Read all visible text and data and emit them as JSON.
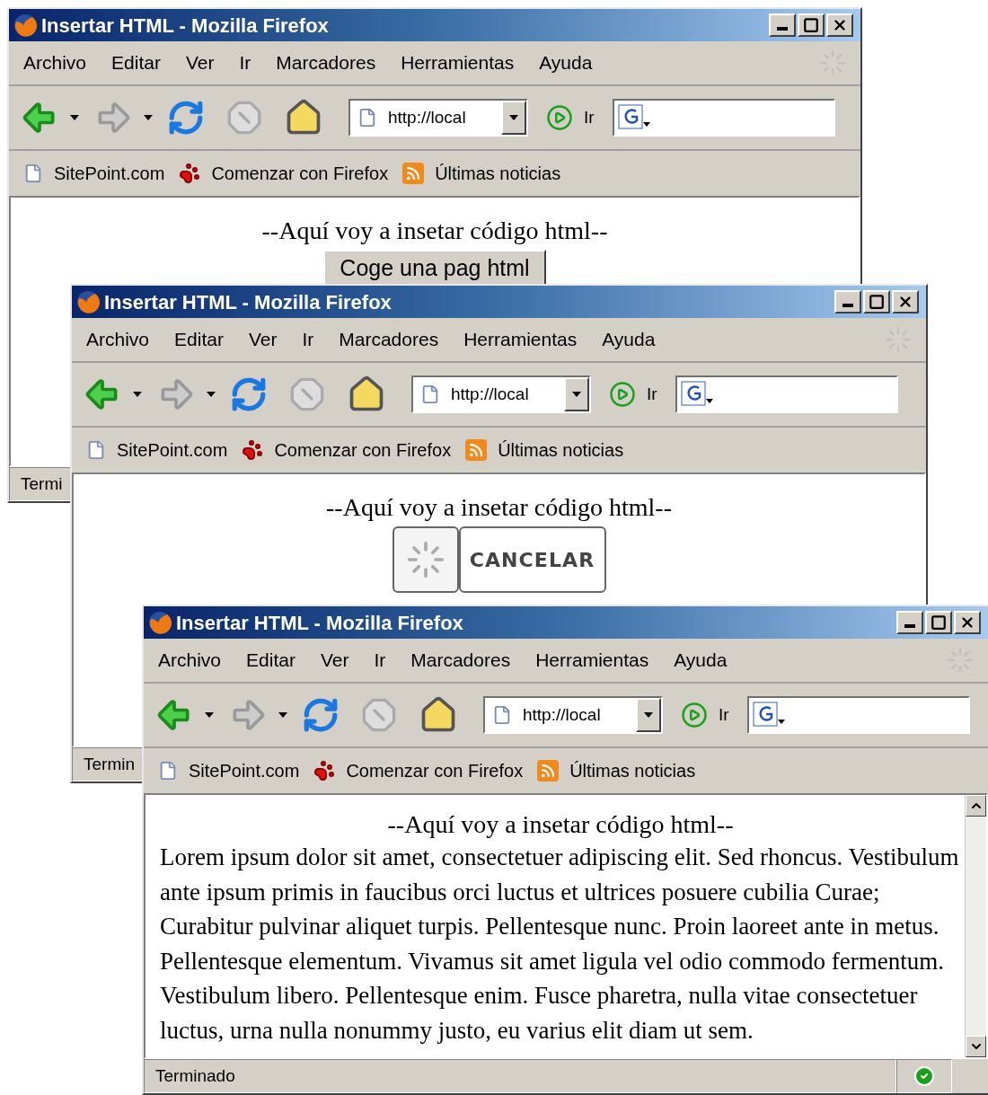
{
  "windows": [
    {
      "title": "Insertar HTML - Mozilla Firefox",
      "menu": [
        "Archivo",
        "Editar",
        "Ver",
        "Ir",
        "Marcadores",
        "Herramientas",
        "Ayuda"
      ],
      "address": "http://local",
      "go_label": "Ir",
      "bookmarks": [
        {
          "label": "SitePoint.com",
          "kind": "page"
        },
        {
          "label": "Comenzar con Firefox",
          "kind": "paw"
        },
        {
          "label": "Últimas noticias",
          "kind": "feed"
        }
      ],
      "content": {
        "kind": "button",
        "heading": "--Aquí voy a insetar código html--",
        "button": "Coge una pag html"
      },
      "status": {
        "text": "Termi"
      }
    },
    {
      "title": "Insertar HTML - Mozilla Firefox",
      "menu": [
        "Archivo",
        "Editar",
        "Ver",
        "Ir",
        "Marcadores",
        "Herramientas",
        "Ayuda"
      ],
      "address": "http://local",
      "go_label": "Ir",
      "bookmarks": [
        {
          "label": "SitePoint.com",
          "kind": "page"
        },
        {
          "label": "Comenzar con Firefox",
          "kind": "paw"
        },
        {
          "label": "Últimas noticias",
          "kind": "feed"
        }
      ],
      "content": {
        "kind": "loading",
        "heading": "--Aquí voy a insetar código html--",
        "button": "CANCELAR"
      },
      "status": {
        "text": "Termin"
      }
    },
    {
      "title": "Insertar HTML - Mozilla Firefox",
      "menu": [
        "Archivo",
        "Editar",
        "Ver",
        "Ir",
        "Marcadores",
        "Herramientas",
        "Ayuda"
      ],
      "address": "http://local",
      "go_label": "Ir",
      "bookmarks": [
        {
          "label": "SitePoint.com",
          "kind": "page"
        },
        {
          "label": "Comenzar con Firefox",
          "kind": "paw"
        },
        {
          "label": "Últimas noticias",
          "kind": "feed"
        }
      ],
      "content": {
        "kind": "text",
        "heading": "--Aquí voy a insetar código html--",
        "paragraph": "Lorem ipsum dolor sit amet, consectetuer adipiscing elit. Sed rhoncus. Vestibulum ante ipsum primis in faucibus orci luctus et ultrices posuere cubilia Curae; Curabitur pulvinar aliquet turpis. Pellentesque nunc. Proin laoreet ante in metus. Pellentesque elementum. Vivamus sit amet ligula vel odio commodo fermentum. Vestibulum libero. Pellentesque enim. Fusce pharetra, nulla vitae consectetuer luctus, urna nulla nonummy justo, eu varius elit diam ut sem."
      },
      "status": {
        "text": "Terminado",
        "done": true
      }
    }
  ]
}
